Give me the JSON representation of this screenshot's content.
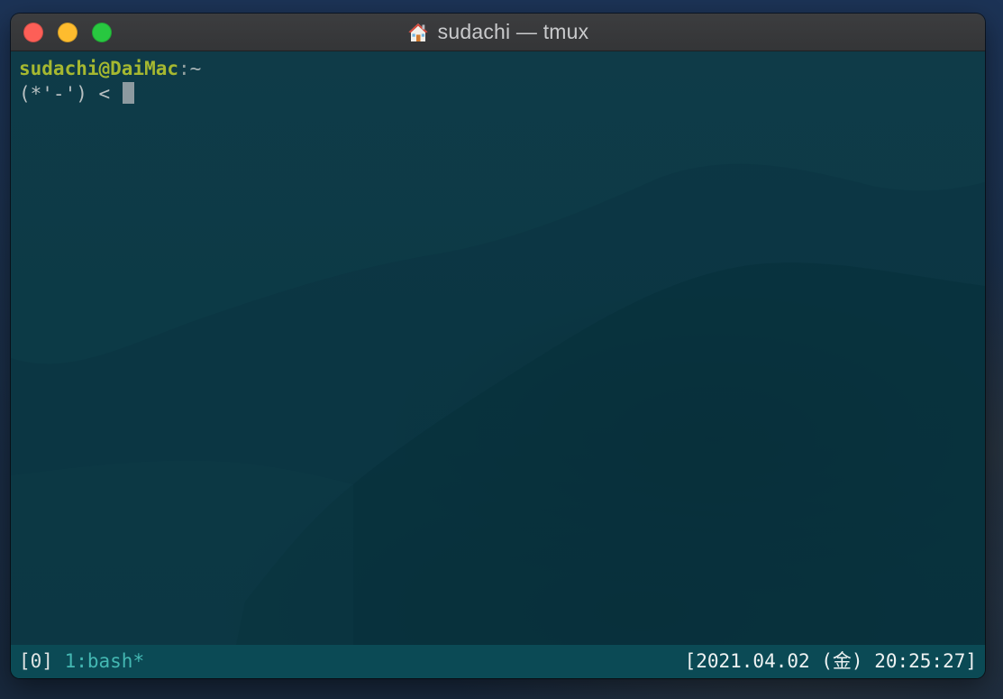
{
  "window": {
    "title": "sudachi — tmux",
    "title_icon": "home-icon"
  },
  "terminal": {
    "prompt_user_host": "sudachi@DaiMac",
    "prompt_colon": ":",
    "prompt_cwd": "~",
    "prompt_face": "(*'-') < "
  },
  "statusbar": {
    "session": "[0]",
    "window_tab": "1:bash*",
    "datetime": "[2021.04.02 (金) 20:25:27]"
  },
  "colors": {
    "terminal_bg": "#0c3a46",
    "prompt_user": "#a6b830",
    "statusbar_bg": "#0b4a55",
    "active_window": "#44b8b3"
  }
}
